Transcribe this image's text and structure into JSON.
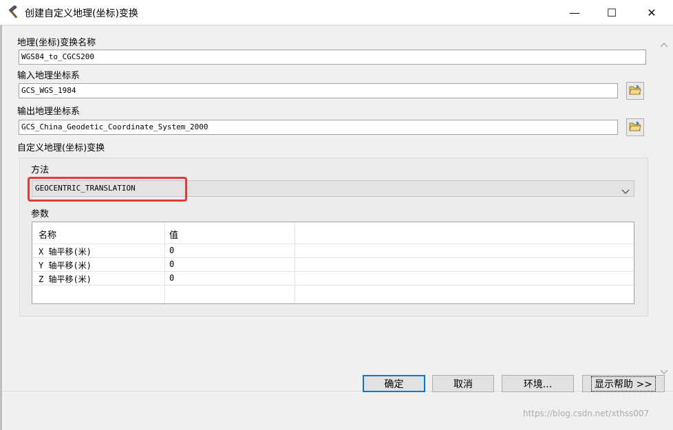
{
  "window": {
    "title": "创建自定义地理(坐标)变换",
    "minimize_glyph": "—",
    "maximize_glyph": "☐",
    "close_glyph": "✕"
  },
  "form": {
    "transform_name_label": "地理(坐标)变换名称",
    "transform_name_value": "WGS84_to_CGCS200",
    "input_gcs_label": "输入地理坐标系",
    "input_gcs_value": "GCS_WGS_1984",
    "output_gcs_label": "输出地理坐标系",
    "output_gcs_value": "GCS_China_Geodetic_Coordinate_System_2000",
    "custom_group_label": "自定义地理(坐标)变换",
    "method_label": "方法",
    "method_value": "GEOCENTRIC_TRANSLATION",
    "params_label": "参数"
  },
  "params_table": {
    "headers": [
      "名称",
      "值"
    ],
    "rows": [
      {
        "name": "X 轴平移(米)",
        "value": "0"
      },
      {
        "name": "Y 轴平移(米)",
        "value": "0"
      },
      {
        "name": "Z 轴平移(米)",
        "value": "0"
      }
    ]
  },
  "buttons": {
    "ok": "确定",
    "cancel": "取消",
    "environments": "环境...",
    "show_help": "显示帮助 >>"
  },
  "watermark": "https://blog.csdn.net/xthss007",
  "colors": {
    "highlight": "#e53935",
    "primary_border": "#0078d7"
  },
  "icons": {
    "title": "hammer-icon",
    "browse": "folder-open-icon",
    "dropdown": "chevron-down-icon"
  }
}
